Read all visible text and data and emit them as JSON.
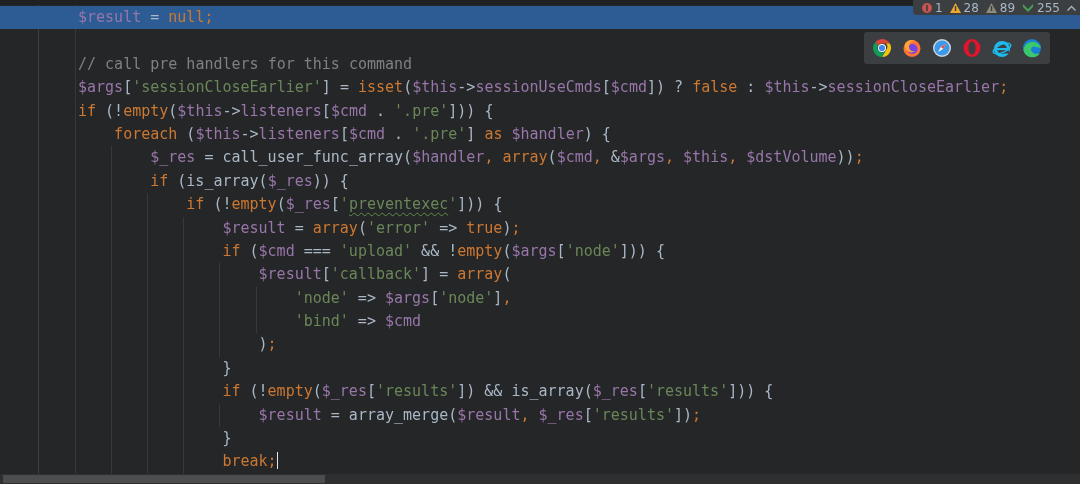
{
  "inspections": [
    {
      "kind": "error",
      "count": "1"
    },
    {
      "kind": "warning",
      "count": "28"
    },
    {
      "kind": "weak_warning",
      "count": "89"
    },
    {
      "kind": "typo",
      "count": "255"
    }
  ],
  "lines": [
    {
      "kind": "code",
      "current": true,
      "caret": false,
      "tokens": [
        {
          "kind": "var",
          "text": "$result"
        },
        {
          "kind": "text",
          "text": " = "
        },
        {
          "kind": "keyword",
          "text": "null"
        },
        {
          "kind": "punct",
          "text": ";"
        }
      ]
    },
    {
      "kind": "blank",
      "current": false,
      "caret": false
    },
    {
      "kind": "code",
      "current": false,
      "caret": false,
      "tokens": [
        {
          "kind": "comment",
          "text": "// call pre handlers for this command"
        }
      ]
    },
    {
      "kind": "code",
      "current": false,
      "caret": false,
      "tokens": [
        {
          "kind": "var",
          "text": "$args"
        },
        {
          "kind": "text",
          "text": "["
        },
        {
          "kind": "string",
          "text": "'sessionCloseEarlier'"
        },
        {
          "kind": "text",
          "text": "] = "
        },
        {
          "kind": "keyword",
          "text": "isset"
        },
        {
          "kind": "text",
          "text": "("
        },
        {
          "kind": "var",
          "text": "$this"
        },
        {
          "kind": "text",
          "text": "->"
        },
        {
          "kind": "var",
          "text": "sessionUseCmds"
        },
        {
          "kind": "text",
          "text": "["
        },
        {
          "kind": "var",
          "text": "$cmd"
        },
        {
          "kind": "text",
          "text": "]) ? "
        },
        {
          "kind": "keyword",
          "text": "false"
        },
        {
          "kind": "text",
          "text": " : "
        },
        {
          "kind": "var",
          "text": "$this"
        },
        {
          "kind": "text",
          "text": "->"
        },
        {
          "kind": "var",
          "text": "sessionCloseEarlier"
        },
        {
          "kind": "punct",
          "text": ";"
        }
      ]
    },
    {
      "kind": "code",
      "current": false,
      "caret": false,
      "tokens": [
        {
          "kind": "keyword",
          "text": "if"
        },
        {
          "kind": "text",
          "text": " (!"
        },
        {
          "kind": "keyword",
          "text": "empty"
        },
        {
          "kind": "text",
          "text": "("
        },
        {
          "kind": "var",
          "text": "$this"
        },
        {
          "kind": "text",
          "text": "->"
        },
        {
          "kind": "var",
          "text": "listeners"
        },
        {
          "kind": "text",
          "text": "["
        },
        {
          "kind": "var",
          "text": "$cmd"
        },
        {
          "kind": "text",
          "text": " . "
        },
        {
          "kind": "string",
          "text": "'.pre'"
        },
        {
          "kind": "text",
          "text": "])) {"
        }
      ],
      "children": [
        {
          "kind": "code",
          "current": false,
          "caret": false,
          "tokens": [
            {
              "kind": "keyword",
              "text": "foreach"
            },
            {
              "kind": "text",
              "text": " ("
            },
            {
              "kind": "var",
              "text": "$this"
            },
            {
              "kind": "text",
              "text": "->"
            },
            {
              "kind": "var",
              "text": "listeners"
            },
            {
              "kind": "text",
              "text": "["
            },
            {
              "kind": "var",
              "text": "$cmd"
            },
            {
              "kind": "text",
              "text": " . "
            },
            {
              "kind": "string",
              "text": "'.pre'"
            },
            {
              "kind": "text",
              "text": "] "
            },
            {
              "kind": "keyword",
              "text": "as"
            },
            {
              "kind": "var",
              "text": " $handler"
            },
            {
              "kind": "text",
              "text": ") {"
            }
          ],
          "children": [
            {
              "kind": "code",
              "current": false,
              "caret": false,
              "tokens": [
                {
                  "kind": "var",
                  "text": "$_res"
                },
                {
                  "kind": "text",
                  "text": " = call_user_func_array("
                },
                {
                  "kind": "var",
                  "text": "$handler"
                },
                {
                  "kind": "punct",
                  "text": ", "
                },
                {
                  "kind": "keyword",
                  "text": "array"
                },
                {
                  "kind": "text",
                  "text": "("
                },
                {
                  "kind": "var",
                  "text": "$cmd"
                },
                {
                  "kind": "punct",
                  "text": ", "
                },
                {
                  "kind": "text",
                  "text": "&"
                },
                {
                  "kind": "var",
                  "text": "$args"
                },
                {
                  "kind": "punct",
                  "text": ", "
                },
                {
                  "kind": "var",
                  "text": "$this"
                },
                {
                  "kind": "punct",
                  "text": ", "
                },
                {
                  "kind": "var",
                  "text": "$dstVolume"
                },
                {
                  "kind": "text",
                  "text": "))"
                },
                {
                  "kind": "punct",
                  "text": ";"
                }
              ]
            },
            {
              "kind": "code",
              "current": false,
              "caret": false,
              "tokens": [
                {
                  "kind": "keyword",
                  "text": "if"
                },
                {
                  "kind": "text",
                  "text": " (is_array("
                },
                {
                  "kind": "var",
                  "text": "$_res"
                },
                {
                  "kind": "text",
                  "text": ")) {"
                }
              ],
              "children": [
                {
                  "kind": "code",
                  "current": false,
                  "caret": false,
                  "tokens": [
                    {
                      "kind": "keyword",
                      "text": "if"
                    },
                    {
                      "kind": "text",
                      "text": " (!"
                    },
                    {
                      "kind": "keyword",
                      "text": "empty"
                    },
                    {
                      "kind": "text",
                      "text": "("
                    },
                    {
                      "kind": "var",
                      "text": "$_res"
                    },
                    {
                      "kind": "text",
                      "text": "["
                    },
                    {
                      "kind": "string",
                      "text": "'"
                    },
                    {
                      "kind": "typo",
                      "text": "preventexec"
                    },
                    {
                      "kind": "string",
                      "text": "'"
                    },
                    {
                      "kind": "text",
                      "text": "])) {"
                    }
                  ],
                  "children": [
                    {
                      "kind": "code",
                      "current": false,
                      "caret": false,
                      "tokens": [
                        {
                          "kind": "var",
                          "text": "$result"
                        },
                        {
                          "kind": "text",
                          "text": " = "
                        },
                        {
                          "kind": "keyword",
                          "text": "array"
                        },
                        {
                          "kind": "text",
                          "text": "("
                        },
                        {
                          "kind": "string",
                          "text": "'error'"
                        },
                        {
                          "kind": "text",
                          "text": " => "
                        },
                        {
                          "kind": "keyword",
                          "text": "true"
                        },
                        {
                          "kind": "text",
                          "text": ")"
                        },
                        {
                          "kind": "punct",
                          "text": ";"
                        }
                      ]
                    },
                    {
                      "kind": "code",
                      "current": false,
                      "caret": false,
                      "tokens": [
                        {
                          "kind": "keyword",
                          "text": "if"
                        },
                        {
                          "kind": "text",
                          "text": " ("
                        },
                        {
                          "kind": "var",
                          "text": "$cmd"
                        },
                        {
                          "kind": "text",
                          "text": " === "
                        },
                        {
                          "kind": "string",
                          "text": "'upload'"
                        },
                        {
                          "kind": "text",
                          "text": " && !"
                        },
                        {
                          "kind": "keyword",
                          "text": "empty"
                        },
                        {
                          "kind": "text",
                          "text": "("
                        },
                        {
                          "kind": "var",
                          "text": "$args"
                        },
                        {
                          "kind": "text",
                          "text": "["
                        },
                        {
                          "kind": "string",
                          "text": "'node'"
                        },
                        {
                          "kind": "text",
                          "text": "])) {"
                        }
                      ],
                      "children": [
                        {
                          "kind": "code",
                          "current": false,
                          "caret": false,
                          "tokens": [
                            {
                              "kind": "var",
                              "text": "$result"
                            },
                            {
                              "kind": "text",
                              "text": "["
                            },
                            {
                              "kind": "string",
                              "text": "'callback'"
                            },
                            {
                              "kind": "text",
                              "text": "] = "
                            },
                            {
                              "kind": "keyword",
                              "text": "array"
                            },
                            {
                              "kind": "text",
                              "text": "("
                            }
                          ],
                          "children": [
                            {
                              "kind": "code",
                              "current": false,
                              "caret": false,
                              "tokens": [
                                {
                                  "kind": "string",
                                  "text": "'node'"
                                },
                                {
                                  "kind": "text",
                                  "text": " => "
                                },
                                {
                                  "kind": "var",
                                  "text": "$args"
                                },
                                {
                                  "kind": "text",
                                  "text": "["
                                },
                                {
                                  "kind": "string",
                                  "text": "'node'"
                                },
                                {
                                  "kind": "text",
                                  "text": "]"
                                },
                                {
                                  "kind": "punct",
                                  "text": ","
                                }
                              ]
                            },
                            {
                              "kind": "code",
                              "current": false,
                              "caret": false,
                              "tokens": [
                                {
                                  "kind": "string",
                                  "text": "'bind'"
                                },
                                {
                                  "kind": "text",
                                  "text": " => "
                                },
                                {
                                  "kind": "var",
                                  "text": "$cmd"
                                }
                              ]
                            }
                          ]
                        },
                        {
                          "kind": "code",
                          "current": false,
                          "caret": false,
                          "tokens": [
                            {
                              "kind": "text",
                              "text": ")"
                            },
                            {
                              "kind": "punct",
                              "text": ";"
                            }
                          ]
                        }
                      ]
                    },
                    {
                      "kind": "code",
                      "current": false,
                      "caret": false,
                      "tokens": [
                        {
                          "kind": "text",
                          "text": "}"
                        }
                      ]
                    },
                    {
                      "kind": "code",
                      "current": false,
                      "caret": false,
                      "tokens": [
                        {
                          "kind": "keyword",
                          "text": "if"
                        },
                        {
                          "kind": "text",
                          "text": " (!"
                        },
                        {
                          "kind": "keyword",
                          "text": "empty"
                        },
                        {
                          "kind": "text",
                          "text": "("
                        },
                        {
                          "kind": "var",
                          "text": "$_res"
                        },
                        {
                          "kind": "text",
                          "text": "["
                        },
                        {
                          "kind": "string",
                          "text": "'results'"
                        },
                        {
                          "kind": "text",
                          "text": "]) && is_array("
                        },
                        {
                          "kind": "var",
                          "text": "$_res"
                        },
                        {
                          "kind": "text",
                          "text": "["
                        },
                        {
                          "kind": "string",
                          "text": "'results'"
                        },
                        {
                          "kind": "text",
                          "text": "])) {"
                        }
                      ],
                      "children": [
                        {
                          "kind": "code",
                          "current": false,
                          "caret": false,
                          "tokens": [
                            {
                              "kind": "var",
                              "text": "$result"
                            },
                            {
                              "kind": "text",
                              "text": " = array_merge("
                            },
                            {
                              "kind": "var",
                              "text": "$result"
                            },
                            {
                              "kind": "punct",
                              "text": ", "
                            },
                            {
                              "kind": "var",
                              "text": "$_res"
                            },
                            {
                              "kind": "text",
                              "text": "["
                            },
                            {
                              "kind": "string",
                              "text": "'results'"
                            },
                            {
                              "kind": "text",
                              "text": "])"
                            },
                            {
                              "kind": "punct",
                              "text": ";"
                            }
                          ]
                        }
                      ]
                    },
                    {
                      "kind": "code",
                      "current": false,
                      "caret": false,
                      "tokens": [
                        {
                          "kind": "text",
                          "text": "}"
                        }
                      ]
                    },
                    {
                      "kind": "code",
                      "current": false,
                      "caret": true,
                      "tokens": [
                        {
                          "kind": "keyword",
                          "text": "break"
                        },
                        {
                          "kind": "punct",
                          "text": ";"
                        }
                      ]
                    }
                  ]
                }
              ]
            }
          ]
        }
      ]
    }
  ]
}
